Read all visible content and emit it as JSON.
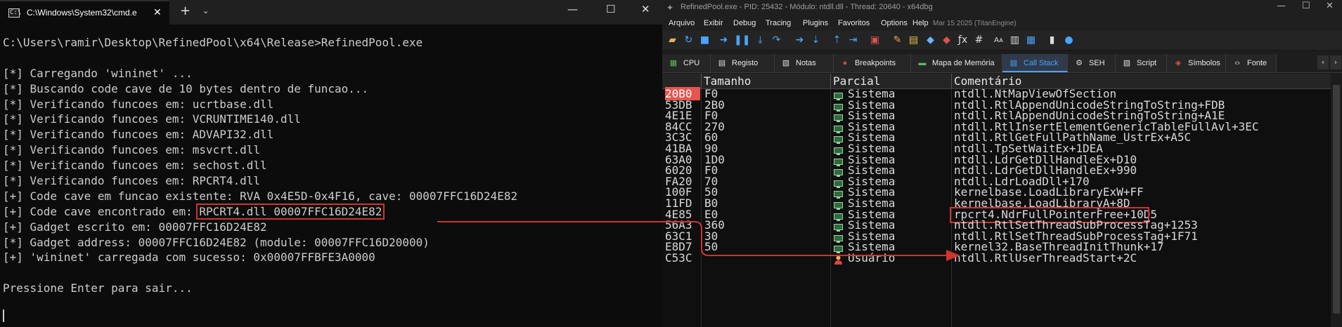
{
  "cmd": {
    "tab_title": "C:\\Windows\\System32\\cmd.e",
    "tab_icon": "terminal-icon",
    "close_glyph": "✕",
    "newtab_glyph": "+",
    "dropdown_glyph": "⌄",
    "minimize_glyph": "—",
    "maximize_glyph": "☐",
    "closewin_glyph": "✕",
    "lines": [
      "",
      "C:\\Users\\ramir\\Desktop\\RefinedPool\\x64\\Release>RefinedPool.exe",
      "",
      "[*] Carregando 'wininet' ...",
      "[*] Buscando code cave de 10 bytes dentro de funcao...",
      "[*] Verificando funcoes em: ucrtbase.dll",
      "[*] Verificando funcoes em: VCRUNTIME140.dll",
      "[*] Verificando funcoes em: ADVAPI32.dll",
      "[*] Verificando funcoes em: msvcrt.dll",
      "[*] Verificando funcoes em: sechost.dll",
      "[*] Verificando funcoes em: RPCRT4.dll",
      "[+] Code cave em funcao existente: RVA 0x4E5D-0x4F16, cave: 00007FFC16D24E82",
      "[+] Code cave encontrado em: ",
      "[+] Gadget escrito em: 00007FFC16D24E82",
      "[*] Gadget address: 00007FFC16D24E82 (module: 00007FFC16D20000)",
      "[+] 'wininet' carregada com sucesso: 0x00007FFBFE3A0000",
      "",
      "Pressione Enter para sair..."
    ],
    "highlight_text": "RPCRT4.dll 00007FFC16D24E82"
  },
  "dbg": {
    "title": "RefinedPool.exe - PID: 25432 - Módulo: ntdll.dll - Thread: 20640 - x64dbg",
    "menu": [
      "Arquivo",
      "Exibir",
      "Debug",
      "Tracing",
      "Plugins",
      "Favoritos",
      "Options",
      "Help"
    ],
    "menu_date": "Mar 15 2025 (TitanEngine)",
    "tabs": [
      {
        "label": "CPU",
        "icon": "cpu-icon"
      },
      {
        "label": "Registo",
        "icon": "log-icon"
      },
      {
        "label": "Notas",
        "icon": "notes-icon"
      },
      {
        "label": "Breakpoints",
        "icon": "breakpoint-icon"
      },
      {
        "label": "Mapa de Memória",
        "icon": "memory-map-icon"
      },
      {
        "label": "Call Stack",
        "icon": "call-stack-icon"
      },
      {
        "label": "SEH",
        "icon": "seh-icon"
      },
      {
        "label": "Script",
        "icon": "script-icon"
      },
      {
        "label": "Símbolos",
        "icon": "symbols-icon"
      },
      {
        "label": "Fonte",
        "icon": "source-icon"
      }
    ],
    "columns": [
      "",
      "Tamanho",
      "Parcial",
      "Comentário"
    ],
    "rows": [
      {
        "addr": "20B0",
        "size": "F0",
        "party": "Sistema",
        "comment": "ntdll.NtMapViewOfSection",
        "selected": true
      },
      {
        "addr": "53DB",
        "size": "2B0",
        "party": "Sistema",
        "comment": "ntdll.RtlAppendUnicodeStringToString+FDB"
      },
      {
        "addr": "4E1E",
        "size": "F0",
        "party": "Sistema",
        "comment": "ntdll.RtlAppendUnicodeStringToString+A1E"
      },
      {
        "addr": "84CC",
        "size": "270",
        "party": "Sistema",
        "comment": "ntdll.RtlInsertElementGenericTableFullAvl+3EC"
      },
      {
        "addr": "3C3C",
        "size": "60",
        "party": "Sistema",
        "comment": "ntdll.RtlGetFullPathName_UstrEx+A5C"
      },
      {
        "addr": "41BA",
        "size": "90",
        "party": "Sistema",
        "comment": "ntdll.TpSetWaitEx+1DEA"
      },
      {
        "addr": "63A0",
        "size": "1D0",
        "party": "Sistema",
        "comment": "ntdll.LdrGetDllHandleEx+D10"
      },
      {
        "addr": "6020",
        "size": "F0",
        "party": "Sistema",
        "comment": "ntdll.LdrGetDllHandleEx+990"
      },
      {
        "addr": "FA20",
        "size": "70",
        "party": "Sistema",
        "comment": "ntdll.LdrLoadDll+170"
      },
      {
        "addr": "100F",
        "size": "50",
        "party": "Sistema",
        "comment": "kernelbase.LoadLibraryExW+FF"
      },
      {
        "addr": "11FD",
        "size": "B0",
        "party": "Sistema",
        "comment": "kernelbase.LoadLibraryA+8D"
      },
      {
        "addr": "4E85",
        "size": "E0",
        "party": "Sistema",
        "comment": "rpcrt4.NdrFullPointerFree+10D5",
        "boxed": true
      },
      {
        "addr": "56A3",
        "size": "360",
        "party": "Sistema",
        "comment": "ntdll.RtlSetThreadSubProcessTag+1253"
      },
      {
        "addr": "63C1",
        "size": "30",
        "party": "Sistema",
        "comment": "ntdll.RtlSetThreadSubProcessTag+1F71"
      },
      {
        "addr": "E8D7",
        "size": "50",
        "party": "Sistema",
        "comment": "kernel32.BaseThreadInitThunk+17"
      },
      {
        "addr": "C53C",
        "size": "",
        "party": "Usuário",
        "comment": "ntdll.RtlUserThreadStart+2C",
        "user": true
      }
    ]
  },
  "colors": {
    "highlight_red": "#d0342c",
    "selected_cell": "#e8544f",
    "active_tab": "#4aa3ff"
  }
}
